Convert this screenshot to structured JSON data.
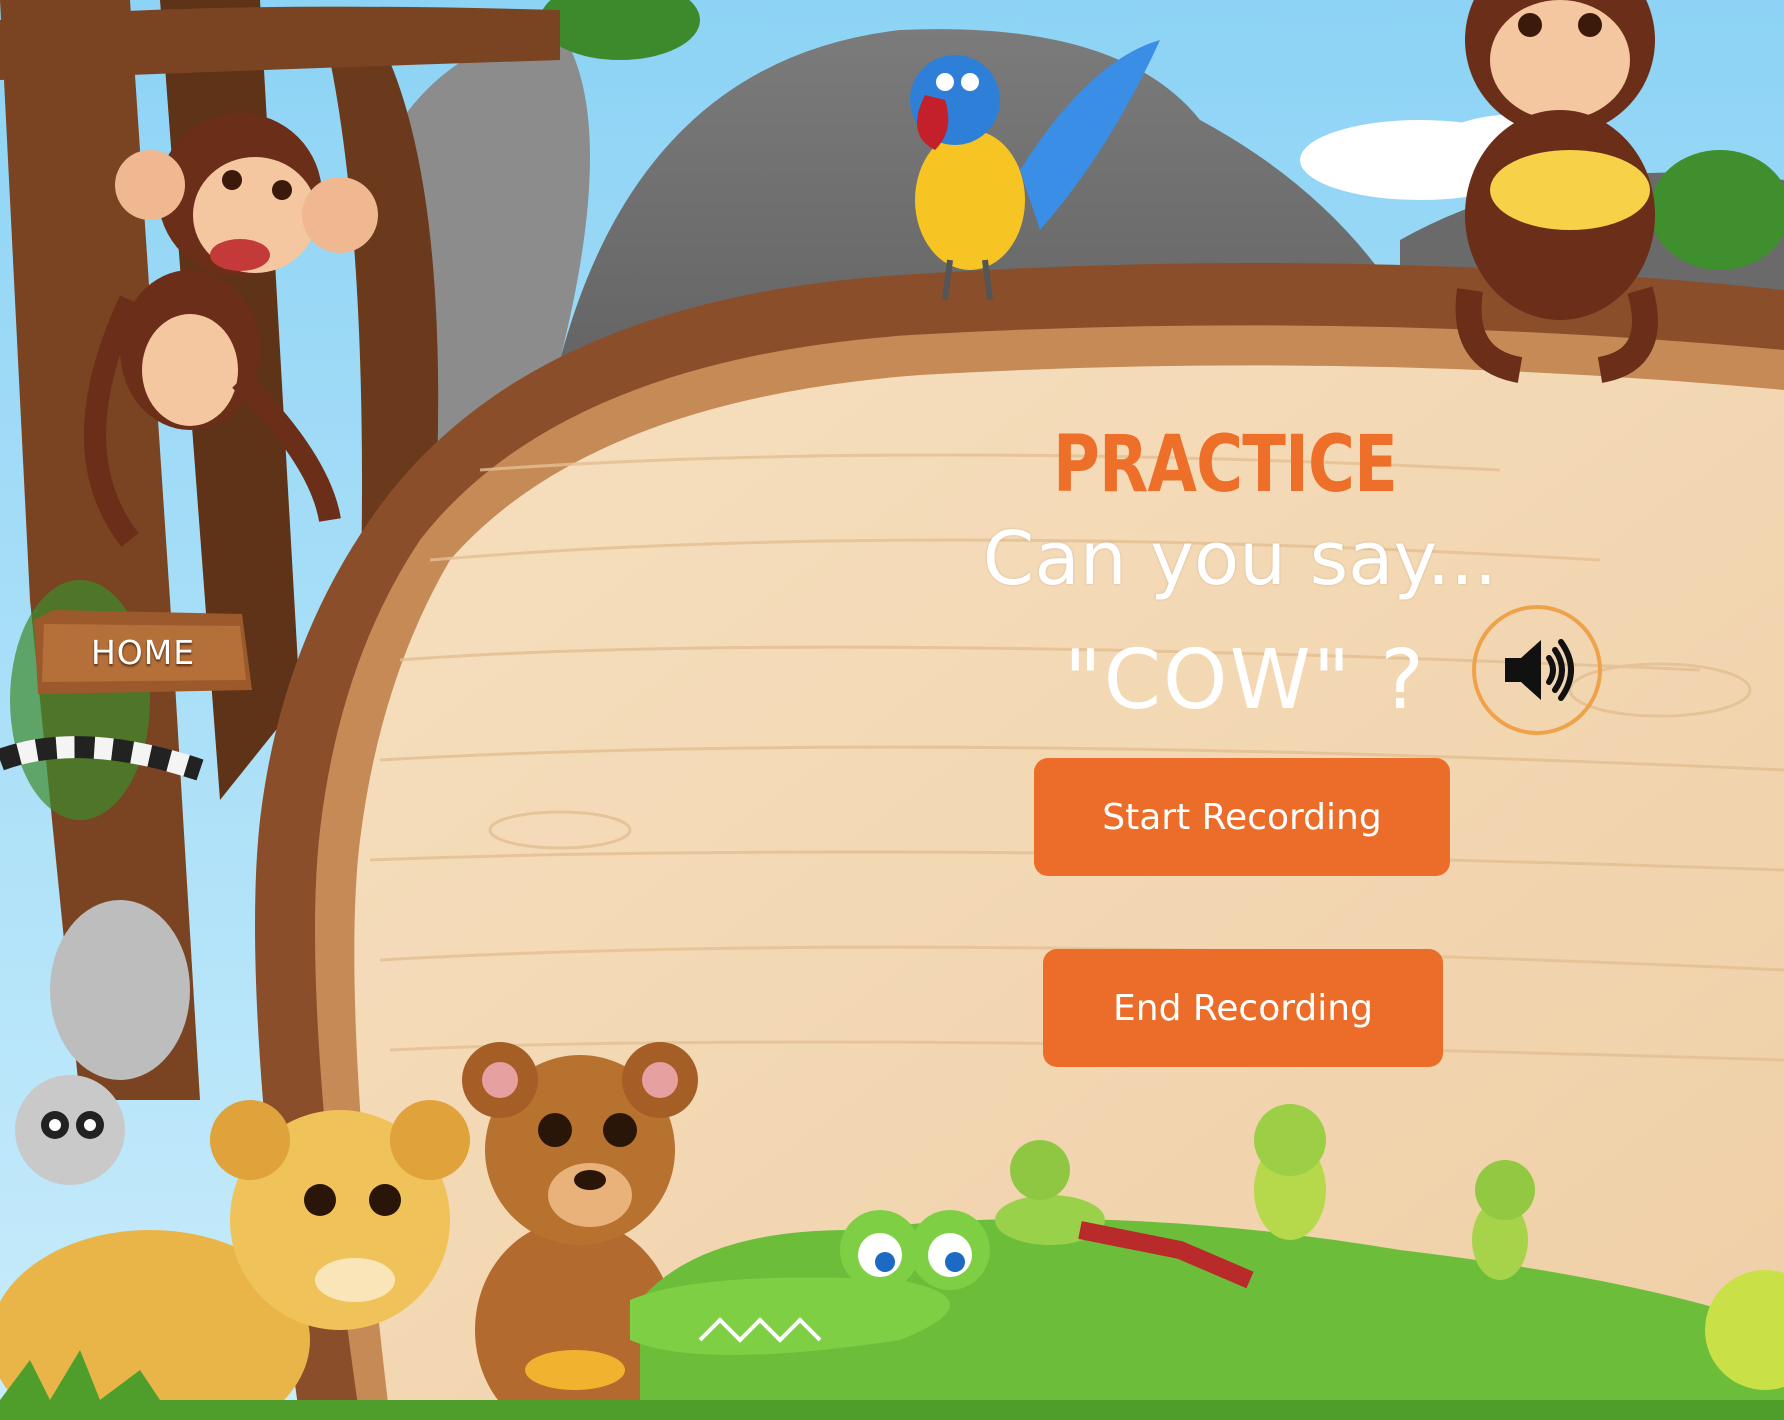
{
  "nav": {
    "home_label": "HOME"
  },
  "lesson": {
    "section_title": "PRACTICE",
    "prompt": "Can you say...",
    "target_word": "\"COW\" ?"
  },
  "controls": {
    "play_sound_icon": "speaker-icon",
    "start_label": "Start Recording",
    "end_label": "End Recording"
  },
  "colors": {
    "accent_orange": "#ec6d2a",
    "speaker_ring": "#f0a24a",
    "board_wood": "#f3d9b6",
    "board_frame": "#8a4f2a",
    "sky": "#9fd8f2"
  },
  "illustration": {
    "scene": "jungle-wooden-sign-board",
    "characters": [
      "monkey-hanging",
      "parrot",
      "monkey-with-bananas",
      "lemur",
      "lion-cub",
      "bear",
      "crocodile",
      "frogs"
    ]
  }
}
